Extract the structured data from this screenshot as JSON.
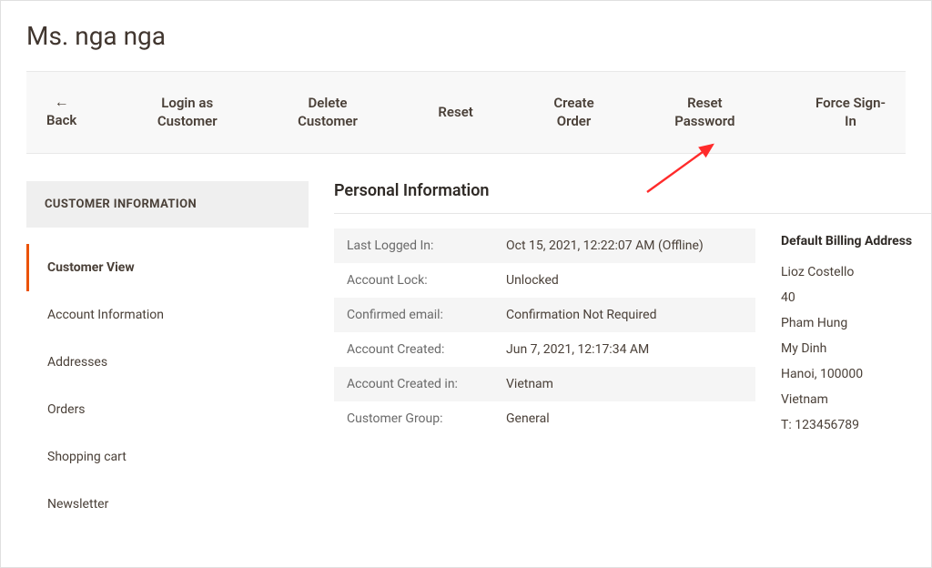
{
  "page_title": "Ms. nga nga",
  "actions": {
    "back": "Back",
    "login_as_customer": "Login as Customer",
    "delete_customer": "Delete Customer",
    "reset": "Reset",
    "create_order": "Create Order",
    "reset_password": "Reset Password",
    "force_signin": "Force Sign-In"
  },
  "sidebar": {
    "header": "CUSTOMER INFORMATION",
    "items": [
      {
        "label": "Customer View",
        "active": true
      },
      {
        "label": "Account Information",
        "active": false
      },
      {
        "label": "Addresses",
        "active": false
      },
      {
        "label": "Orders",
        "active": false
      },
      {
        "label": "Shopping cart",
        "active": false
      },
      {
        "label": "Newsletter",
        "active": false
      }
    ]
  },
  "section_title": "Personal Information",
  "info": {
    "last_logged_in": {
      "label": "Last Logged In:",
      "value": "Oct 15, 2021, 12:22:07 AM (Offline)"
    },
    "account_lock": {
      "label": "Account Lock:",
      "value": "Unlocked"
    },
    "confirmed_email": {
      "label": "Confirmed email:",
      "value": "Confirmation Not Required"
    },
    "account_created": {
      "label": "Account Created:",
      "value": "Jun 7, 2021, 12:17:34 AM"
    },
    "account_created_in": {
      "label": "Account Created in:",
      "value": "Vietnam"
    },
    "customer_group": {
      "label": "Customer Group:",
      "value": "General"
    }
  },
  "billing": {
    "title": "Default Billing Address",
    "name": "Lioz Costello",
    "line1": "40",
    "line2": "Pham Hung",
    "line3": "My Dinh",
    "city_zip": "Hanoi, 100000",
    "country": "Vietnam",
    "phone": "T: 123456789"
  }
}
